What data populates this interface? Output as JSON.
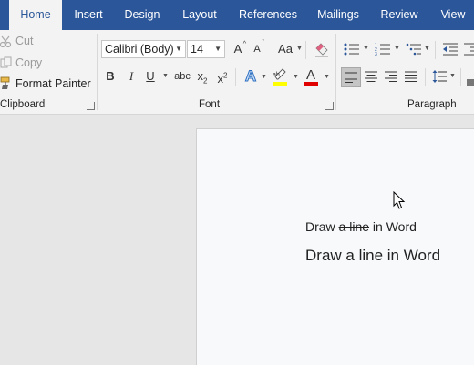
{
  "tabs": [
    {
      "label": "Home",
      "active": true
    },
    {
      "label": "Insert"
    },
    {
      "label": "Design"
    },
    {
      "label": "Layout"
    },
    {
      "label": "References"
    },
    {
      "label": "Mailings"
    },
    {
      "label": "Review"
    },
    {
      "label": "View"
    }
  ],
  "clipboard": {
    "cut": "Cut",
    "copy": "Copy",
    "format_painter": "Format Painter",
    "group_label": "Clipboard"
  },
  "font": {
    "font_name": "Calibri (Body)",
    "font_size": "14",
    "change_case": "Aa",
    "bold": "B",
    "italic": "I",
    "underline": "U",
    "strikethrough": "abc",
    "subscript": "x",
    "subscript_sub": "2",
    "superscript": "x",
    "superscript_sup": "2",
    "text_effects": "A",
    "font_color_letter": "A",
    "grow_font": "A",
    "shrink_font": "A",
    "group_label": "Font"
  },
  "paragraph": {
    "group_label": "Paragraph"
  },
  "colors": {
    "ribbon_blue": "#2b579a",
    "highlight": "#ffff00",
    "font_color": "#e00000"
  },
  "document": {
    "line1_before": "Draw ",
    "line1_struck": "a line",
    "line1_after": " in Word",
    "line2": "Draw a line in Word"
  }
}
